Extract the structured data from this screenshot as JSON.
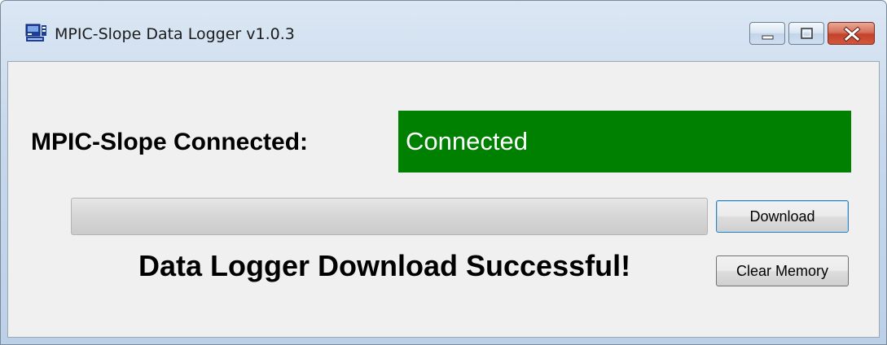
{
  "window": {
    "title": "MPIC-Slope Data Logger  v1.0.3",
    "icon": "app-icon",
    "controls": [
      "minimize-icon",
      "maximize-icon",
      "close-icon"
    ]
  },
  "connection": {
    "label": "MPIC-Slope Connected:",
    "status": "Connected",
    "status_color": "#008000"
  },
  "progress": {
    "value_percent": 0
  },
  "buttons": {
    "download_label": "Download",
    "clear_memory_label": "Clear Memory"
  },
  "message": {
    "text": "Data Logger Download Successful!"
  }
}
